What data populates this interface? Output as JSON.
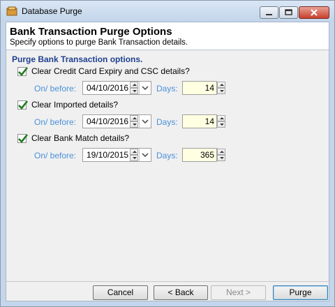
{
  "window": {
    "title": "Database Purge"
  },
  "header": {
    "title": "Bank Transaction Purge Options",
    "subtitle": "Specify options to purge Bank Transaction details."
  },
  "group": {
    "title": "Purge Bank Transaction options."
  },
  "options": [
    {
      "label": "Clear Credit Card Expiry and CSC details?",
      "checked": true,
      "on_before_label": "On/ before:",
      "date": "04/10/2016",
      "days_label": "Days:",
      "days": "14"
    },
    {
      "label": "Clear Imported details?",
      "checked": true,
      "on_before_label": "On/ before:",
      "date": "04/10/2016",
      "days_label": "Days:",
      "days": "14"
    },
    {
      "label": "Clear Bank Match details?",
      "checked": true,
      "on_before_label": "On/ before:",
      "date": "19/10/2015",
      "days_label": "Days:",
      "days": "365"
    }
  ],
  "buttons": {
    "cancel": "Cancel",
    "back": "< Back",
    "next": "Next >",
    "purge": "Purge"
  },
  "colors": {
    "accent_blue": "#4a90d9",
    "group_title": "#1f3f8f",
    "days_bg": "#ffffe1",
    "check": "#1f7a1f"
  },
  "icons": {
    "app": "database-icon",
    "minimize": "minimize-icon",
    "maximize": "maximize-icon",
    "close": "close-icon",
    "check": "checkmark-icon",
    "dropdown": "chevron-down-icon"
  }
}
